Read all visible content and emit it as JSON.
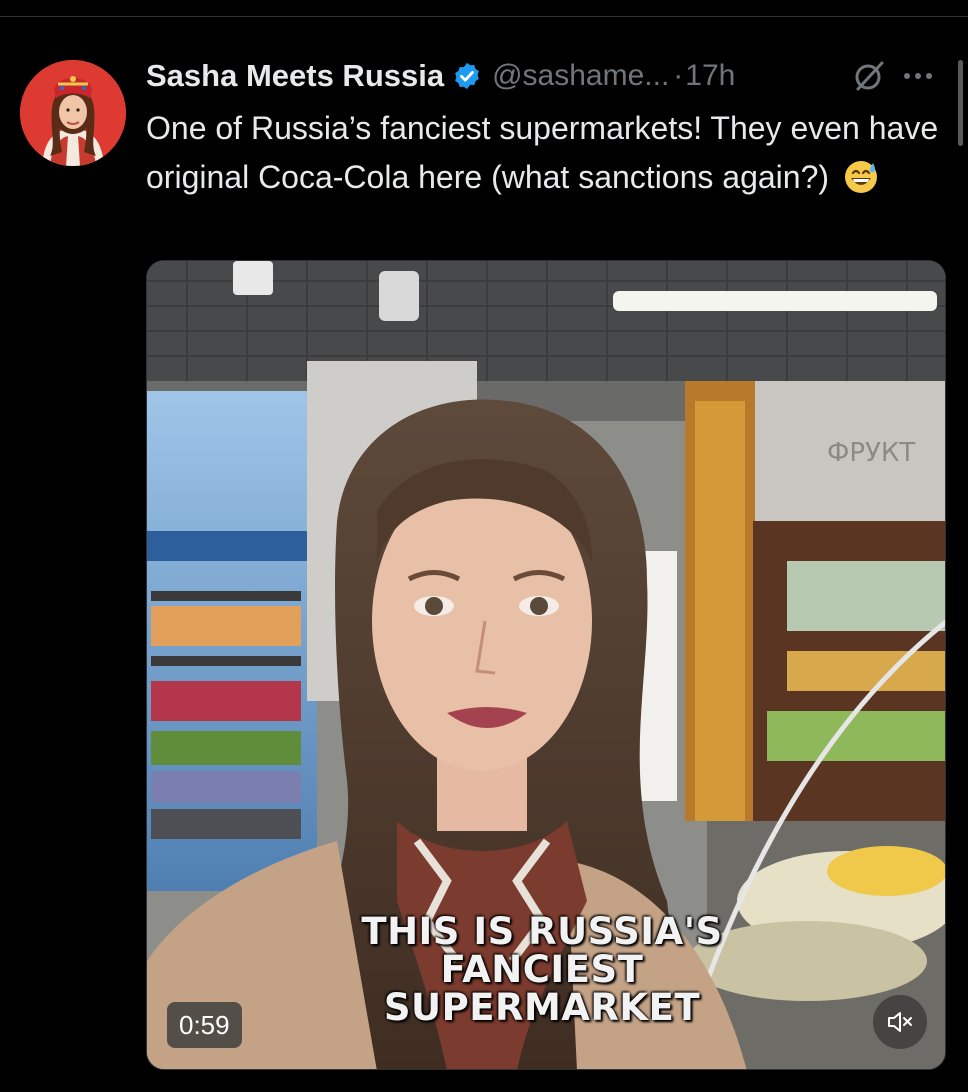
{
  "author": {
    "display_name": "Sasha Meets Russia",
    "handle": "@sashame...",
    "separator": "·",
    "timestamp": "17h",
    "verified": true,
    "verified_color": "#1d9bf0"
  },
  "tweet": {
    "text": "One of Russia’s fanciest supermarkets! They even have original Coca-Cola here (what sanctions again?)",
    "emoji": "grinning-face-with-sweat-emoji"
  },
  "icons": {
    "grok": "grok-icon",
    "more": "more-options-icon",
    "mute": "speaker-muted-icon"
  },
  "video": {
    "caption_lines": [
      "THIS IS RUSSIA'S",
      "FANCIEST",
      "SUPERMARKET"
    ],
    "duration": "0:59",
    "store_sign": "ФРУКТ"
  }
}
